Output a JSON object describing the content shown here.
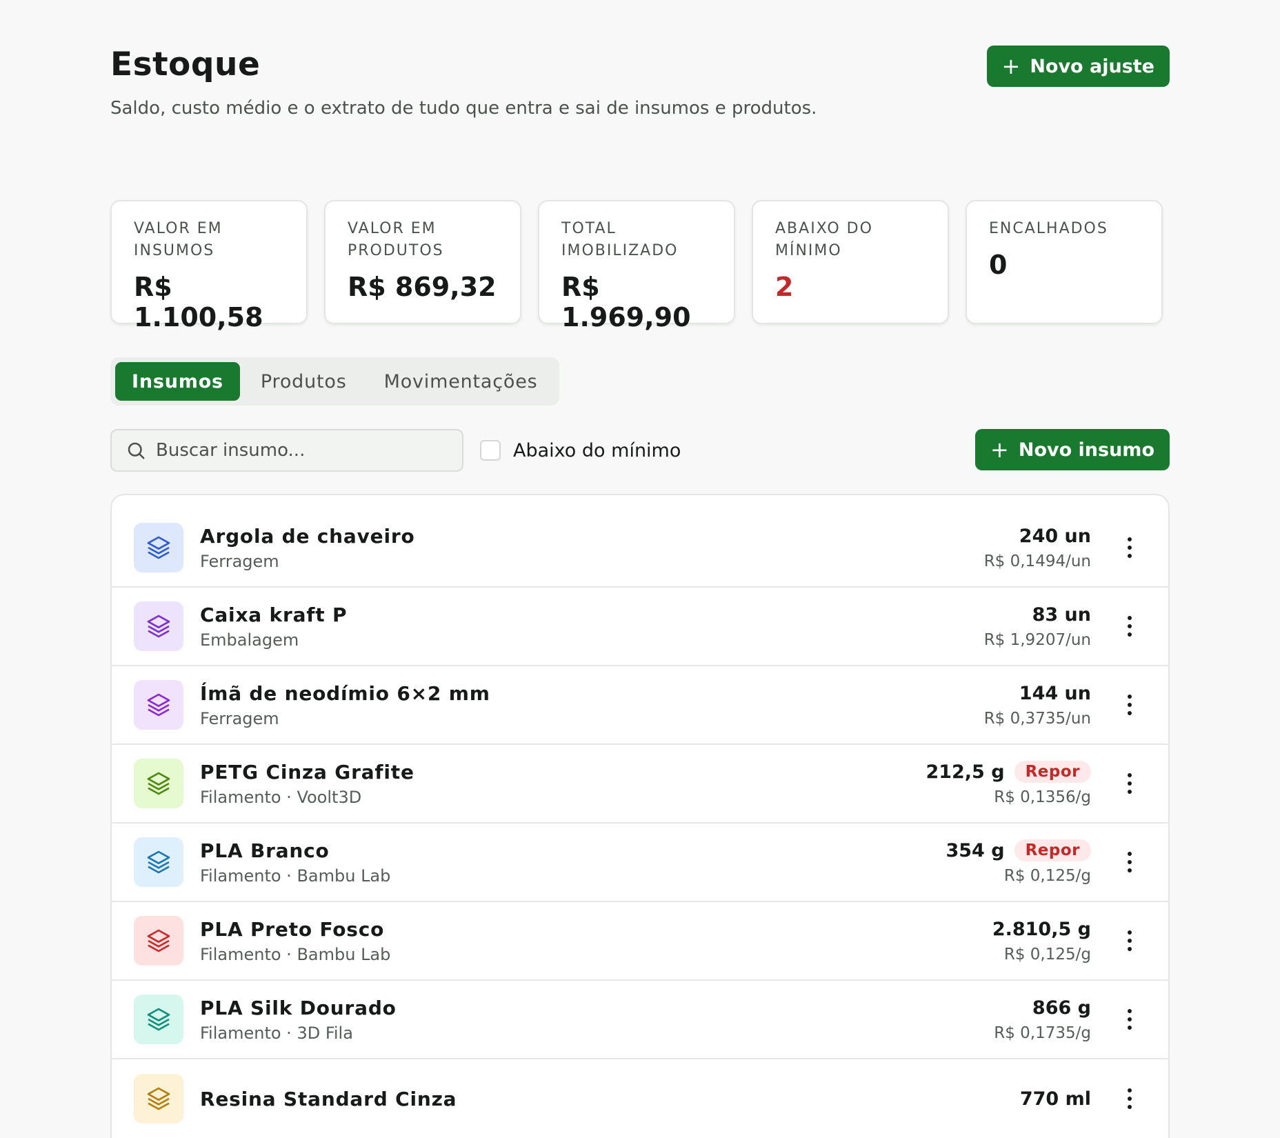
{
  "header": {
    "title": "Estoque",
    "subtitle": "Saldo, custo médio e o extrato de tudo que entra e sai de insumos e produtos.",
    "new_adjust_label": "Novo ajuste"
  },
  "kpis": [
    {
      "label": "VALOR EM INSUMOS",
      "value": "R$ 1.100,58"
    },
    {
      "label": "VALOR EM PRODUTOS",
      "value": "R$ 869,32"
    },
    {
      "label": "TOTAL IMOBILIZADO",
      "value": "R$ 1.969,90"
    },
    {
      "label": "ABAIXO DO MÍNIMO",
      "value": "2"
    },
    {
      "label": "ENCALHADOS",
      "value": "0"
    }
  ],
  "tabs": [
    {
      "label": "Insumos",
      "active": true
    },
    {
      "label": "Produtos",
      "active": false
    },
    {
      "label": "Movimentações",
      "active": false
    }
  ],
  "filters": {
    "search_placeholder": "Buscar insumo...",
    "search_value": "",
    "below_min_label": "Abaixo do mínimo",
    "below_min_checked": false,
    "new_item_label": "Novo insumo"
  },
  "colors": {
    "primary": "#18792f",
    "alert": "#c62828"
  },
  "items": [
    {
      "name": "Argola de chaveiro",
      "sub": "Ferragem",
      "qty": "240 un",
      "cost": "R$ 0,1494/un",
      "badge": "",
      "icon": "layers-icon",
      "icon_bg": "#dde8fd",
      "icon_fg": "#2f5bd3"
    },
    {
      "name": "Caixa kraft P",
      "sub": "Embalagem",
      "qty": "83 un",
      "cost": "R$ 1,9207/un",
      "badge": "",
      "icon": "layers-icon",
      "icon_bg": "#ede3fc",
      "icon_fg": "#7e2fd6"
    },
    {
      "name": "Ímã de neodímio 6×2 mm",
      "sub": "Ferragem",
      "qty": "144 un",
      "cost": "R$ 0,3735/un",
      "badge": "",
      "icon": "layers-icon",
      "icon_bg": "#f0e3fb",
      "icon_fg": "#8a2bd4"
    },
    {
      "name": "PETG Cinza Grafite",
      "sub": "Filamento · Voolt3D",
      "qty": "212,5 g",
      "cost": "R$ 0,1356/g",
      "badge": "Repor",
      "icon": "layers-icon",
      "icon_bg": "#e6fad0",
      "icon_fg": "#4e8a12"
    },
    {
      "name": "PLA Branco",
      "sub": "Filamento · Bambu Lab",
      "qty": "354 g",
      "cost": "R$ 0,125/g",
      "badge": "Repor",
      "icon": "layers-icon",
      "icon_bg": "#ddf0fc",
      "icon_fg": "#1a78b8"
    },
    {
      "name": "PLA Preto Fosco",
      "sub": "Filamento · Bambu Lab",
      "qty": "2.810,5 g",
      "cost": "R$ 0,125/g",
      "badge": "",
      "icon": "layers-icon",
      "icon_bg": "#fde1e1",
      "icon_fg": "#cc2a2a"
    },
    {
      "name": "PLA Silk Dourado",
      "sub": "Filamento · 3D Fila",
      "qty": "866 g",
      "cost": "R$ 0,1735/g",
      "badge": "",
      "icon": "layers-icon",
      "icon_bg": "#d5f7ee",
      "icon_fg": "#13907a"
    },
    {
      "name": "Resina Standard Cinza",
      "sub": "",
      "qty": "770 ml",
      "cost": "",
      "badge": "",
      "icon": "layers-icon",
      "icon_bg": "#fdf1d6",
      "icon_fg": "#b57f0e"
    }
  ]
}
